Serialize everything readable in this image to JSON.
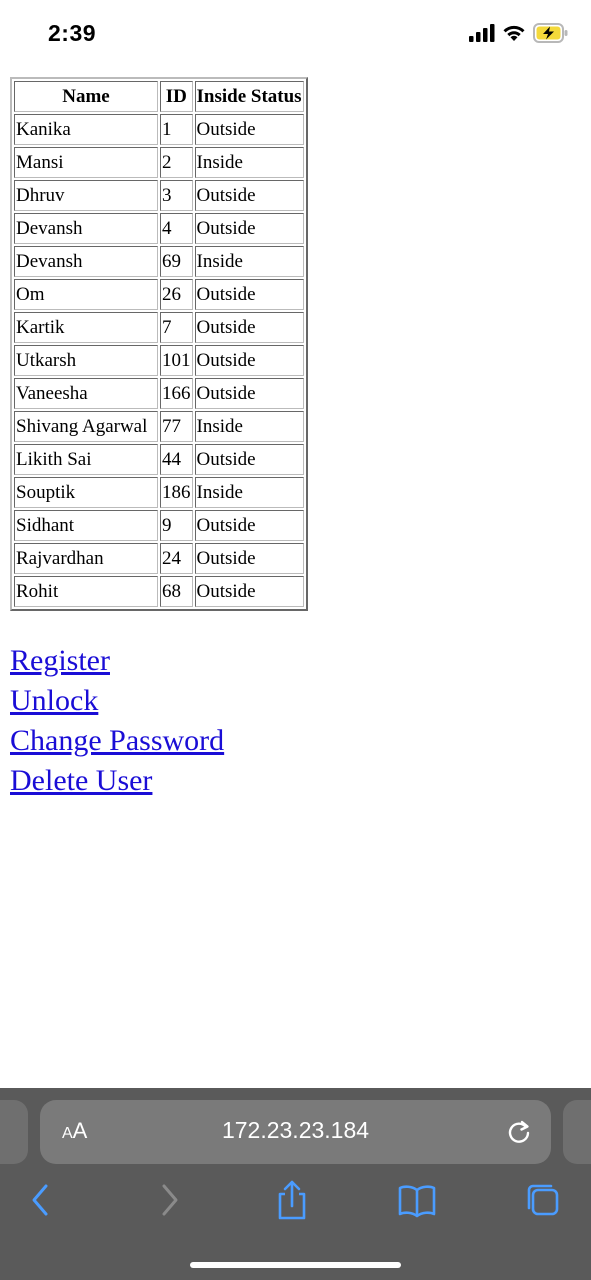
{
  "status_bar": {
    "time": "2:39",
    "icons": [
      "cellular-signal-icon",
      "wifi-icon",
      "battery-charging-icon"
    ],
    "battery_color": "#f4d93a"
  },
  "table": {
    "headers": [
      "Name",
      "ID",
      "Inside Status"
    ],
    "rows": [
      [
        "Kanika",
        "1",
        "Outside"
      ],
      [
        "Mansi",
        "2",
        "Inside"
      ],
      [
        "Dhruv",
        "3",
        "Outside"
      ],
      [
        "Devansh",
        "4",
        "Outside"
      ],
      [
        "Devansh",
        "69",
        "Inside"
      ],
      [
        "Om",
        "26",
        "Outside"
      ],
      [
        "Kartik",
        "7",
        "Outside"
      ],
      [
        "Utkarsh",
        "101",
        "Outside"
      ],
      [
        "Vaneesha",
        "166",
        "Outside"
      ],
      [
        "Shivang Agarwal",
        "77",
        "Inside"
      ],
      [
        "Likith Sai",
        "44",
        "Outside"
      ],
      [
        "Souptik",
        "186",
        "Inside"
      ],
      [
        "Sidhant",
        "9",
        "Outside"
      ],
      [
        "Rajvardhan",
        "24",
        "Outside"
      ],
      [
        "Rohit",
        "68",
        "Outside"
      ]
    ]
  },
  "links": [
    {
      "label": "Register",
      "name": "register-link"
    },
    {
      "label": "Unlock",
      "name": "unlock-link"
    },
    {
      "label": "Change Password",
      "name": "change-password-link"
    },
    {
      "label": "Delete User",
      "name": "delete-user-link"
    }
  ],
  "browser": {
    "aa_label_small": "A",
    "aa_label_large": "A",
    "url": "172.23.23.184",
    "toolbar_icons": [
      "back-icon",
      "forward-icon",
      "share-icon",
      "bookmarks-icon",
      "tabs-icon"
    ],
    "accent_color": "#4a9cff",
    "bar_color": "#5a5a5a"
  }
}
